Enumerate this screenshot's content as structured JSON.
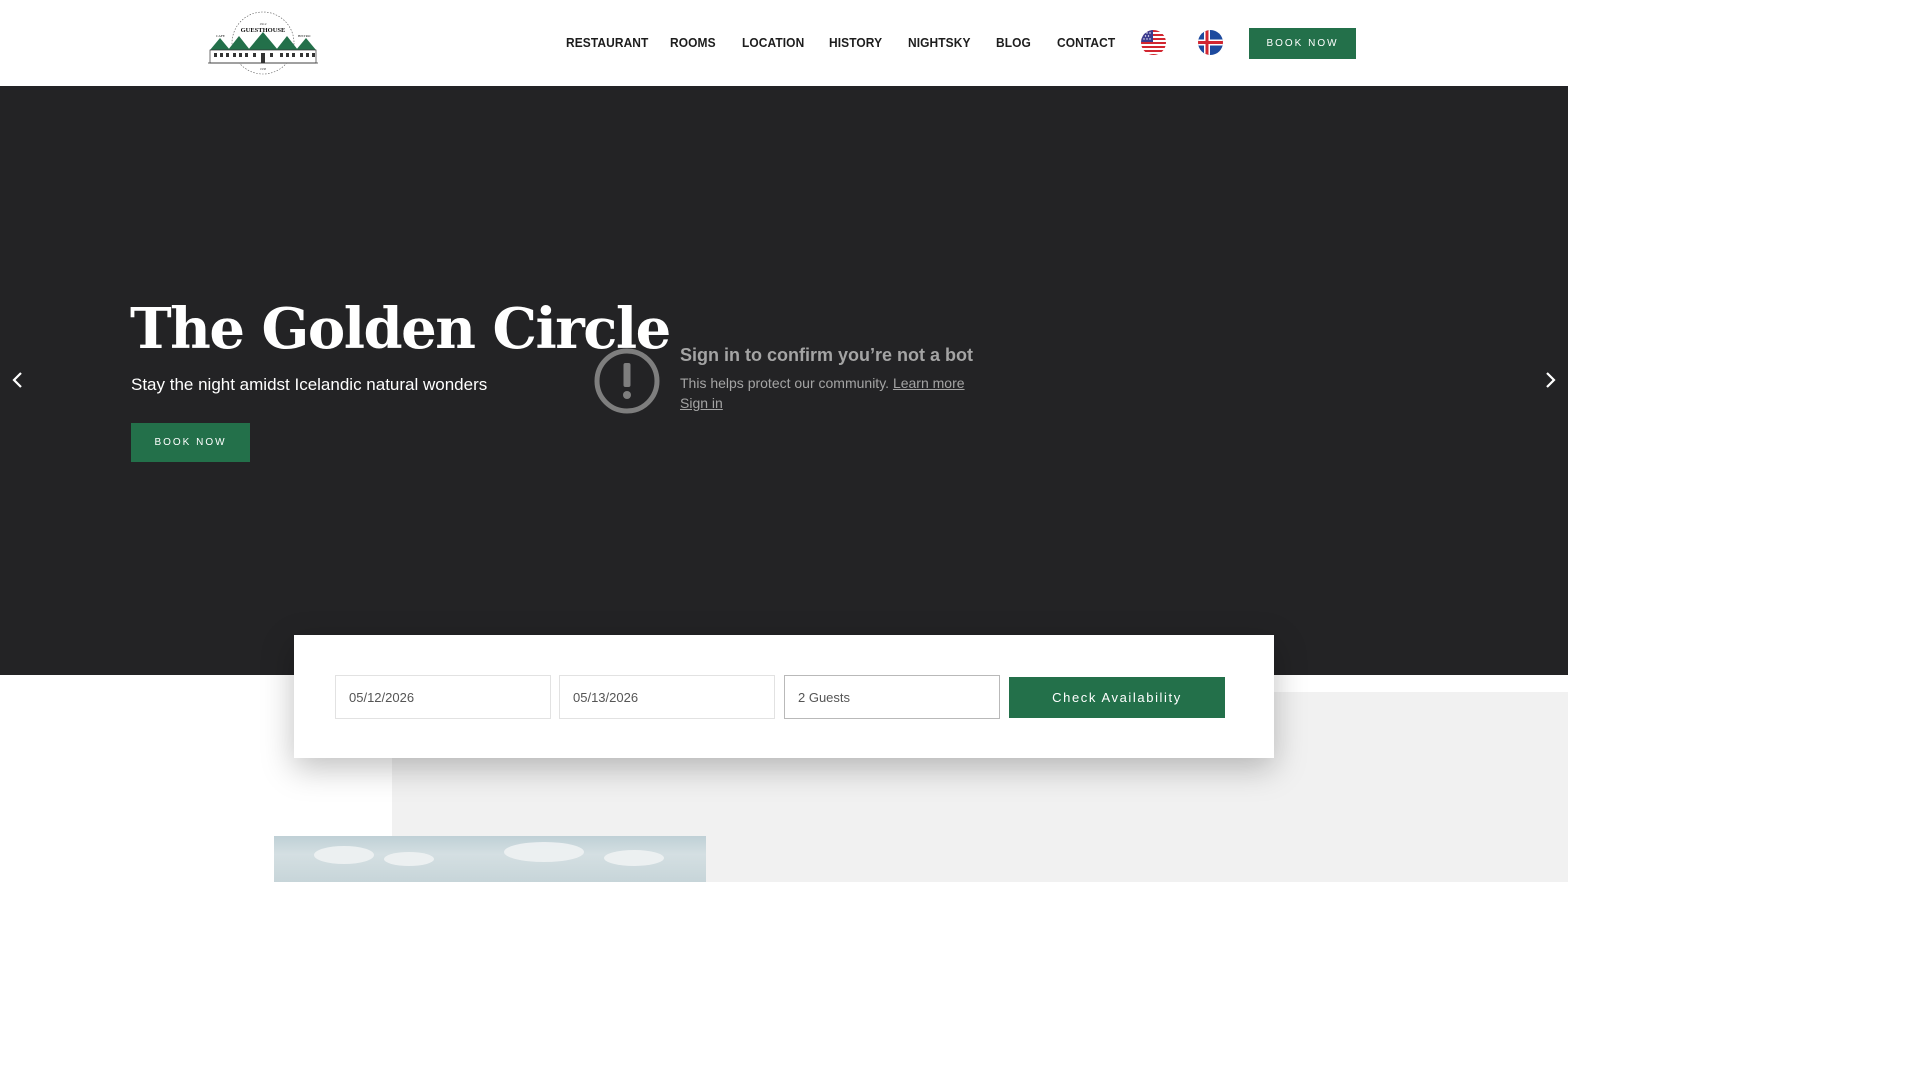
{
  "header": {
    "logo": {
      "name": "guesthouse-logo",
      "text": "GUESTHOUSE",
      "left_text": "CAFE",
      "right_text": "BISTRO"
    },
    "nav": [
      "RESTAURANT",
      "ROOMS",
      "LOCATION",
      "HISTORY",
      "NIGHTSKY",
      "BLOG",
      "CONTACT"
    ],
    "flags": [
      "us-flag-icon",
      "iceland-flag-icon"
    ],
    "book_label": "BOOK NOW"
  },
  "hero": {
    "title": "The Golden Circle",
    "subtitle": "Stay the night amidst Icelandic natural wonders",
    "book_label": "BOOK NOW",
    "prev_icon": "chevron-left-icon",
    "next_icon": "chevron-right-icon"
  },
  "bot_notice": {
    "title": "Sign in to confirm you’re not a bot",
    "text": "This helps protect our community.",
    "learn_more": "Learn more",
    "sign_in": "Sign in",
    "icon": "alert-icon"
  },
  "booking": {
    "checkin": "05/12/2026",
    "checkout": "05/13/2026",
    "guests": "2 Guests",
    "button": "Check Availability"
  },
  "colors": {
    "brand_green": "#23704a",
    "hero_bg": "#232325",
    "muted_text": "#a4a4a4"
  }
}
